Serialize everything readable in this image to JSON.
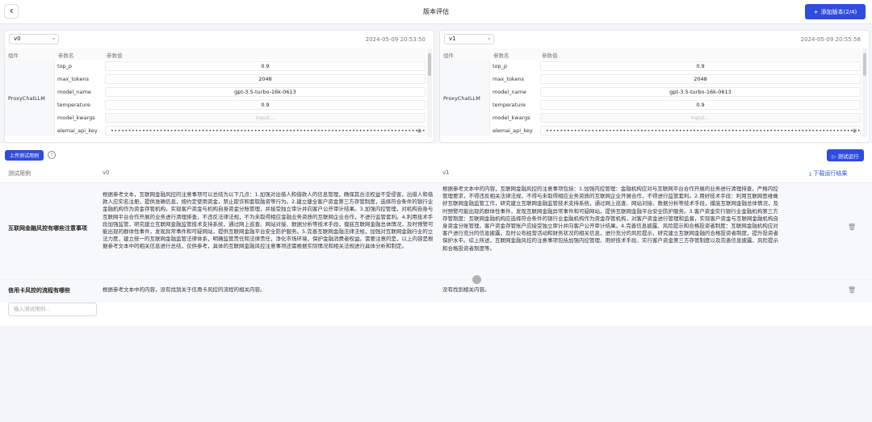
{
  "header": {
    "title": "版本评估",
    "add_version_label": "添加版本(2/4)"
  },
  "params_header": {
    "component": "组件",
    "param_name": "参数名",
    "param_value": "参数值"
  },
  "versions": [
    {
      "name": "v0",
      "time": "2024-05-09 20:53:50",
      "component": "ProxyChatLLM",
      "params": [
        {
          "name": "top_p",
          "value": "0.9"
        },
        {
          "name": "max_tokens",
          "value": "2048"
        },
        {
          "name": "model_name",
          "value": "gpt-3.5-turbo-16k-0613"
        },
        {
          "name": "temperature",
          "value": "0.9"
        },
        {
          "name": "model_kwargs",
          "value": "Input..."
        },
        {
          "name": "elemai_api_key",
          "value": "••••••••••••••••••••••••••••••••••••••••••••••••••••••••••••••••••••••••••••••••••••••••••••••••••••••"
        }
      ]
    },
    {
      "name": "v1",
      "time": "2024-05-09 20:55:58",
      "component": "ProxyChatLLM",
      "params": [
        {
          "name": "top_p",
          "value": "0.9"
        },
        {
          "name": "max_tokens",
          "value": "2048"
        },
        {
          "name": "model_name",
          "value": "gpt-3.5-turbo-16k-0613"
        },
        {
          "name": "temperature",
          "value": "0.9"
        },
        {
          "name": "model_kwargs",
          "value": "Input..."
        },
        {
          "name": "elemai_api_key",
          "value": "••••••••••••••••••••••••••••••••••••••••••••••••••••••••••••••••••••••••••••••••••••••••••••••••••••••"
        }
      ]
    }
  ],
  "toolbar": {
    "upload_label": "上传测试用例",
    "help_icon": "question-circle-icon",
    "run_label": "▷ 测试运行"
  },
  "results": {
    "col_case": "测试用例",
    "col_v0": "v0",
    "col_v1": "v1",
    "download_label": "⤓ 下载运行结果",
    "rows": [
      {
        "case": "互联网金融风控有哪些注意事项",
        "v0": "根据参考文本，互联网金融风控的注意事项可以总结为以下几点：1.加强对出借人和借款人的信息管理，确保其合法权益不受侵害，出借人和借款人应实名注册，提供准确信息，按约定使用资金，禁止欺诈和套取融资等行为。2.建立健全客户资金第三方存管制度，选择符合条件的银行业金融机构作为资金存管机构，实现客户资金与机构自身资金分账管理，并接受独立审计并向客户公开审计结果。3.加强内控管理，对机构自身与互联网平台合作开展的业务进行清理排查，不违反法律法规，不为未取得相应金融业务资质的互联网企业合作，不进行监管套利。4.利用技术手段加强监管，研究建立互联网金融监管技术支持系统，通过网上巡查、网站对接、数据分析等技术手段，摸底互联网金融总体情况，及时预警可能出现的群体性事件，发现异常事件和可疑网站，提供互联网金融平台安全防护服务。5.完善互联网金融法律法规，加强对互联网金融行业的立法力度，建立统一的互联网金融监管法律体系，明确监管责任和法律责任，净化市场环境，保护金融消费者权益。需要注意的是，以上内容是根据参考文本中的相关信息进行总结，仅供参考，具体的互联网金融风控注意事项还需根据实际情况和相关法规进行具体分析和制定。",
        "v1": "根据参考文本中的内容，互联网金融风控的注意事项包括：1.加强内控管理：金融机构应对与互联网平台合作开展的业务进行清理排查，严格内控管理要求，不得违反相关法律法规，不得与未取得相应业务资质的互联网企业开展合作，不得进行监管套利。2.用好技术手段：利用互联网思维做好互联网金融监管工作，研究建立互联网金融监管技术支持系统，通过网上巡查、网站对接、数据分析等技术手段，摸底互联网金融总体情况，及时预警可能出现的群体性事件，发现互联网金融异常事件和可疑网站，提供互联网金融平台安全防护服务。3.客户资金实行银行业金融机构第三方存管制度：互联网金融机构应选择符合条件的银行业金融机构作为资金存管机构，对客户资金进行管理和监督，实现客户资金与互联网金融机构自身资金分账管理，客户资金存管账户应接受独立审计并向客户公开审计结果。4.完善信息披露、风险提示和合格投资者制度：互联网金融机构应对客户进行充分的信息披露，及时公布经营活动和财务状况的相关信息，进行充分的风险提示，研究建立互联网金融的合格投资者制度，提升投资者保护水平。综上所述，互联网金融风控的注意事项包括加强内控管理、用好技术手段、实行客户资金第三方存管制度以及完善信息披露、风险提示和合格投资者制度等。"
      },
      {
        "case": "信用卡风控的流程有哪些",
        "v0": "根据参考文本中的内容，没有找到关于信用卡风控的流程的相关内容。",
        "v1": "没有找到相关内容。"
      }
    ],
    "input_placeholder": "输入测试用例..."
  }
}
